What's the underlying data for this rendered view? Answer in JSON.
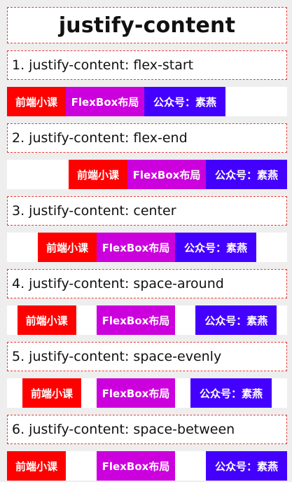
{
  "title": "justify-content",
  "items": [
    "前端小课",
    "FlexBox布局",
    "公众号：素燕"
  ],
  "colors": {
    "item1": "#ff0000",
    "item2": "#cc00dd",
    "item3": "#4400ff",
    "border": "#e53935",
    "background": "#eeeeee"
  },
  "sections": [
    {
      "label": "1. justify-content: flex-start",
      "justify": "flex-start"
    },
    {
      "label": "2. justify-content: flex-end",
      "justify": "flex-end"
    },
    {
      "label": "3. justify-content: center",
      "justify": "center"
    },
    {
      "label": "4. justify-content: space-around",
      "justify": "space-around"
    },
    {
      "label": "5. justify-content: space-evenly",
      "justify": "space-evenly"
    },
    {
      "label": "6. justify-content: space-between",
      "justify": "space-between"
    }
  ]
}
